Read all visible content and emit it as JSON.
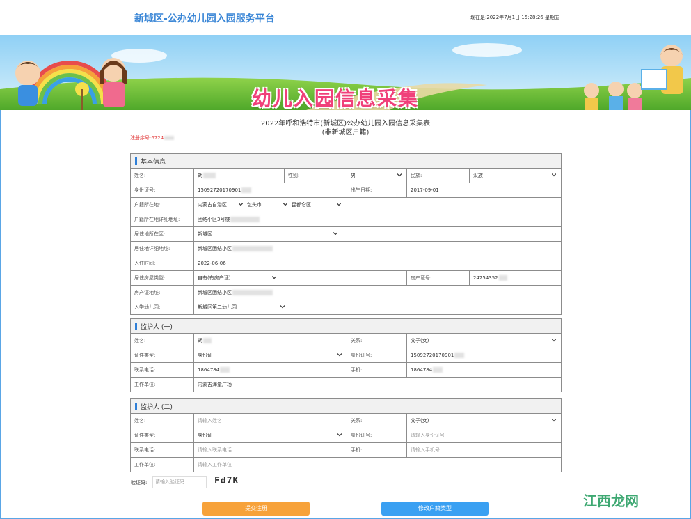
{
  "header": {
    "site_title": "新城区-公办幼儿园入园服务平台",
    "datetime": "现在是:2022年7月1日 15:28:26 星期五"
  },
  "banner": {
    "title": "幼儿入园信息采集"
  },
  "form": {
    "title_line1": "2022年呼和浩特市(新城区)公办幼儿园入园信息采集表",
    "title_line2": "(非新城区户籍)",
    "reg_no": "注册序号:6724"
  },
  "basic": {
    "section_title": "基本信息",
    "name_label": "姓名:",
    "name_value": "胡",
    "gender_label": "性别:",
    "gender_value": "男",
    "ethnic_label": "民族:",
    "ethnic_value": "汉族",
    "id_label": "身份证号:",
    "id_value": "15092720170901",
    "birth_label": "出生日期:",
    "birth_value": "2017-09-01",
    "hukou_label": "户籍所在地:",
    "hukou_region": "内蒙古自治区",
    "hukou_city": "包头市",
    "hukou_district": "昆都仑区",
    "hukou_addr_label": "户籍所在地详细地址:",
    "hukou_addr_value": "团结小区3号楼",
    "res_district_label": "居住地所在区:",
    "res_district_value": "新城区",
    "res_addr_label": "居住地详细地址:",
    "res_addr_value": "新城区团结小区",
    "movein_label": "入住时间:",
    "movein_value": "2022-06-06",
    "house_type_label": "居住房屋类型:",
    "house_type_value": "自有(有房产证)",
    "cert_label": "房产证号:",
    "cert_value": "24254352",
    "cert_addr_label": "房产证地址:",
    "cert_addr_value": "新城区团结小区",
    "kg_label": "入学幼儿园:",
    "kg_value": "新城区第二幼儿园"
  },
  "guardian1": {
    "section_title": "监护人 (一)",
    "name_label": "姓名:",
    "name_value": "胡",
    "rel_label": "关系:",
    "rel_value": "父子(女)",
    "idtype_label": "证件类型:",
    "idtype_value": "身份证",
    "id_label": "身份证号:",
    "id_value": "15092720170901",
    "phone_label": "联系电话:",
    "phone_value": "1864784",
    "mobile_label": "手机:",
    "mobile_value": "1864784",
    "work_label": "工作单位:",
    "work_value": "内蒙古海量广场"
  },
  "guardian2": {
    "section_title": "监护人 (二)",
    "name_label": "姓名:",
    "name_ph": "请输入姓名",
    "rel_label": "关系:",
    "rel_value": "父子(女)",
    "idtype_label": "证件类型:",
    "idtype_value": "身份证",
    "id_label": "身份证号:",
    "id_ph": "请输入身份证号",
    "phone_label": "联系电话:",
    "phone_ph": "请输入联系电话",
    "mobile_label": "手机:",
    "mobile_ph": "请输入手机号",
    "work_label": "工作单位:",
    "work_ph": "请输入工作单位"
  },
  "captcha": {
    "label": "验证码:",
    "placeholder": "请输入验证码",
    "code": "Fd7K"
  },
  "buttons": {
    "submit": "提交注册",
    "modify": "修改户籍类型"
  },
  "watermark": "江西龙网",
  "colors": {
    "accent": "#3a86d6",
    "submit": "#f7a23a",
    "modify": "#3aa0f2"
  }
}
